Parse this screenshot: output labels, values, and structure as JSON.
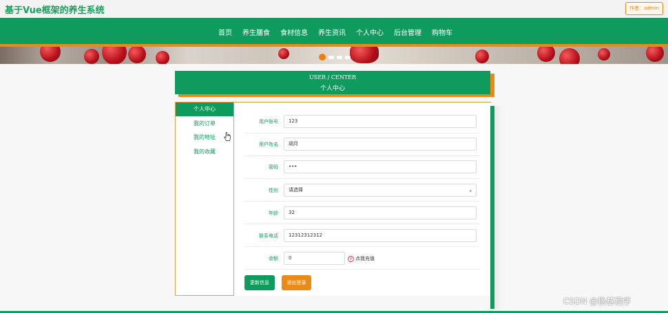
{
  "header": {
    "site_title": "基于Vue框架的养生系统",
    "author_badge": "作者：admin"
  },
  "nav": {
    "items": [
      "首页",
      "养生膳食",
      "食材信息",
      "养生资讯",
      "个人中心",
      "后台管理",
      "购物车"
    ]
  },
  "banner": {
    "slide_count": 4,
    "active_slide": 1
  },
  "section_header": {
    "en": "USER / CENTER",
    "cn": "个人中心"
  },
  "sidebar": {
    "items": [
      "个人中心",
      "我的订单",
      "我的地址",
      "我的收藏"
    ],
    "active": "个人中心"
  },
  "form": {
    "username": {
      "label": "用户账号",
      "value": "123"
    },
    "name": {
      "label": "用户姓名",
      "value": "胡月"
    },
    "password": {
      "label": "密码",
      "value": "•••"
    },
    "gender": {
      "label": "性别",
      "value": "请选择"
    },
    "age": {
      "label": "年龄",
      "value": "32"
    },
    "phone": {
      "label": "联系电话",
      "value": "12312312312"
    },
    "balance": {
      "label": "余额",
      "value": "0",
      "recharge_label": "点我充值"
    }
  },
  "buttons": {
    "update": "更新信息",
    "logout": "退出登录"
  },
  "watermark": "CSDN @扬基程序",
  "colors": {
    "primary_green": "#0f9b5d",
    "accent_orange": "#e98b16"
  }
}
